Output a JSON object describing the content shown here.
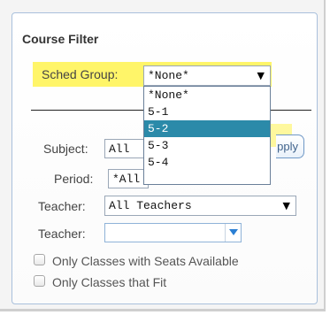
{
  "panel": {
    "title": "Course Filter"
  },
  "sched_group": {
    "label": "Sched Group:",
    "value": "*None*",
    "options": [
      "*None*",
      "5-1",
      "5-2",
      "5-3",
      "5-4"
    ],
    "highlighted_option": "5-2"
  },
  "subject": {
    "label": "Subject:",
    "value": "All"
  },
  "apply_button": {
    "label": "pply"
  },
  "period": {
    "label": "Period:",
    "value": "*All"
  },
  "teacher1": {
    "label": "Teacher:",
    "value": "All Teachers"
  },
  "teacher2": {
    "label": "Teacher:",
    "value": ""
  },
  "checkboxes": [
    {
      "label": "Only Classes with Seats Available",
      "checked": false
    },
    {
      "label": "Only Classes that Fit",
      "checked": false
    }
  ],
  "colors": {
    "highlight": "#fff34f",
    "selected_option": "#2b8aa9",
    "panel_border": "#a9c0dc"
  }
}
